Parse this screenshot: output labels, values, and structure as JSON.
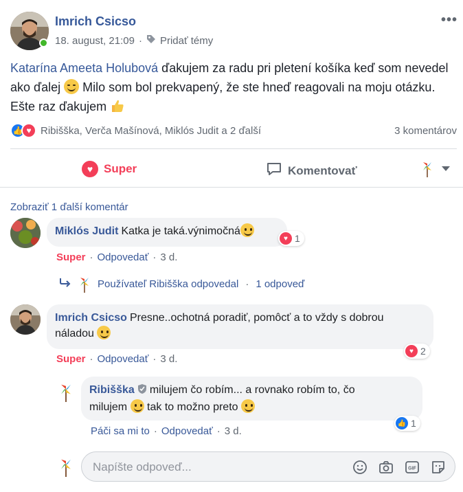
{
  "post": {
    "author": "Imrich Csicso",
    "date": "18. august, 21:09",
    "meta_sep": "·",
    "add_topics": "Pridať témy",
    "mention": "Katarína Ameeta Holubová",
    "text_part1": " ďakujem za radu pri pletení košíka keď som nevedel ako ďalej ",
    "text_part2": " Milo som bol prekvapený, že ste hneď reagovali na moju otázku. Ešte raz ďakujem ",
    "reactors": "Ribišška, Verča Mašínová, Miklós Judit a 2 ďalší",
    "comments_count": "3 komentárov"
  },
  "actions": {
    "super_label": "Super",
    "comment_label": "Komentovať"
  },
  "comments_section": {
    "more_comments": "Zobraziť 1 ďalší komentár",
    "comment1": {
      "author": "Miklós Judit",
      "text": "Katka je taká.výnimočná",
      "reaction_count": "1",
      "react_label": "Super",
      "reply_label": "Odpovedať",
      "time": "3 d."
    },
    "replies_link": {
      "text": "Používateľ Ribišška odpovedal",
      "count": "1 odpoveď"
    },
    "comment2": {
      "author": "Imrich Csicso",
      "text_line1": "Presne..ochotná poradiť, pomôcť a to vždy s dobrou",
      "text_line2": "náladou",
      "reaction_count": "2",
      "react_label": "Super",
      "reply_label": "Odpovedať",
      "time": "3 d."
    },
    "reply1": {
      "author": "Ribišška",
      "text_line1": "milujem čo robím... a rovnako robím to, čo",
      "text_line2a": "milujem",
      "text_line2b": "tak to možno preto",
      "reaction_count": "1",
      "like_label": "Páči sa mi to",
      "reply_label": "Odpovedať",
      "time": "3 d."
    },
    "reply_box": {
      "placeholder": "Napíšte odpoveď..."
    },
    "sep": "·"
  },
  "colors": {
    "link_blue": "#385898",
    "love_red": "#f33e58",
    "like_blue": "#1877f2",
    "bubble_gray": "#f2f3f5"
  }
}
